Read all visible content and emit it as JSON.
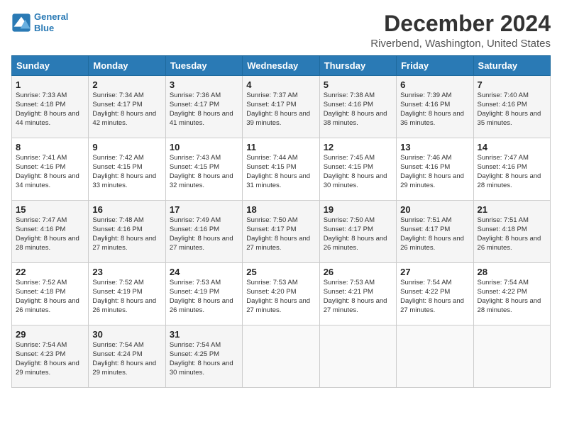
{
  "header": {
    "logo_line1": "General",
    "logo_line2": "Blue",
    "month": "December 2024",
    "location": "Riverbend, Washington, United States"
  },
  "weekdays": [
    "Sunday",
    "Monday",
    "Tuesday",
    "Wednesday",
    "Thursday",
    "Friday",
    "Saturday"
  ],
  "weeks": [
    [
      {
        "day": "1",
        "sunrise": "7:33 AM",
        "sunset": "4:18 PM",
        "daylight": "8 hours and 44 minutes."
      },
      {
        "day": "2",
        "sunrise": "7:34 AM",
        "sunset": "4:17 PM",
        "daylight": "8 hours and 42 minutes."
      },
      {
        "day": "3",
        "sunrise": "7:36 AM",
        "sunset": "4:17 PM",
        "daylight": "8 hours and 41 minutes."
      },
      {
        "day": "4",
        "sunrise": "7:37 AM",
        "sunset": "4:17 PM",
        "daylight": "8 hours and 39 minutes."
      },
      {
        "day": "5",
        "sunrise": "7:38 AM",
        "sunset": "4:16 PM",
        "daylight": "8 hours and 38 minutes."
      },
      {
        "day": "6",
        "sunrise": "7:39 AM",
        "sunset": "4:16 PM",
        "daylight": "8 hours and 36 minutes."
      },
      {
        "day": "7",
        "sunrise": "7:40 AM",
        "sunset": "4:16 PM",
        "daylight": "8 hours and 35 minutes."
      }
    ],
    [
      {
        "day": "8",
        "sunrise": "7:41 AM",
        "sunset": "4:16 PM",
        "daylight": "8 hours and 34 minutes."
      },
      {
        "day": "9",
        "sunrise": "7:42 AM",
        "sunset": "4:15 PM",
        "daylight": "8 hours and 33 minutes."
      },
      {
        "day": "10",
        "sunrise": "7:43 AM",
        "sunset": "4:15 PM",
        "daylight": "8 hours and 32 minutes."
      },
      {
        "day": "11",
        "sunrise": "7:44 AM",
        "sunset": "4:15 PM",
        "daylight": "8 hours and 31 minutes."
      },
      {
        "day": "12",
        "sunrise": "7:45 AM",
        "sunset": "4:15 PM",
        "daylight": "8 hours and 30 minutes."
      },
      {
        "day": "13",
        "sunrise": "7:46 AM",
        "sunset": "4:16 PM",
        "daylight": "8 hours and 29 minutes."
      },
      {
        "day": "14",
        "sunrise": "7:47 AM",
        "sunset": "4:16 PM",
        "daylight": "8 hours and 28 minutes."
      }
    ],
    [
      {
        "day": "15",
        "sunrise": "7:47 AM",
        "sunset": "4:16 PM",
        "daylight": "8 hours and 28 minutes."
      },
      {
        "day": "16",
        "sunrise": "7:48 AM",
        "sunset": "4:16 PM",
        "daylight": "8 hours and 27 minutes."
      },
      {
        "day": "17",
        "sunrise": "7:49 AM",
        "sunset": "4:16 PM",
        "daylight": "8 hours and 27 minutes."
      },
      {
        "day": "18",
        "sunrise": "7:50 AM",
        "sunset": "4:17 PM",
        "daylight": "8 hours and 27 minutes."
      },
      {
        "day": "19",
        "sunrise": "7:50 AM",
        "sunset": "4:17 PM",
        "daylight": "8 hours and 26 minutes."
      },
      {
        "day": "20",
        "sunrise": "7:51 AM",
        "sunset": "4:17 PM",
        "daylight": "8 hours and 26 minutes."
      },
      {
        "day": "21",
        "sunrise": "7:51 AM",
        "sunset": "4:18 PM",
        "daylight": "8 hours and 26 minutes."
      }
    ],
    [
      {
        "day": "22",
        "sunrise": "7:52 AM",
        "sunset": "4:18 PM",
        "daylight": "8 hours and 26 minutes."
      },
      {
        "day": "23",
        "sunrise": "7:52 AM",
        "sunset": "4:19 PM",
        "daylight": "8 hours and 26 minutes."
      },
      {
        "day": "24",
        "sunrise": "7:53 AM",
        "sunset": "4:19 PM",
        "daylight": "8 hours and 26 minutes."
      },
      {
        "day": "25",
        "sunrise": "7:53 AM",
        "sunset": "4:20 PM",
        "daylight": "8 hours and 27 minutes."
      },
      {
        "day": "26",
        "sunrise": "7:53 AM",
        "sunset": "4:21 PM",
        "daylight": "8 hours and 27 minutes."
      },
      {
        "day": "27",
        "sunrise": "7:54 AM",
        "sunset": "4:22 PM",
        "daylight": "8 hours and 27 minutes."
      },
      {
        "day": "28",
        "sunrise": "7:54 AM",
        "sunset": "4:22 PM",
        "daylight": "8 hours and 28 minutes."
      }
    ],
    [
      {
        "day": "29",
        "sunrise": "7:54 AM",
        "sunset": "4:23 PM",
        "daylight": "8 hours and 29 minutes."
      },
      {
        "day": "30",
        "sunrise": "7:54 AM",
        "sunset": "4:24 PM",
        "daylight": "8 hours and 29 minutes."
      },
      {
        "day": "31",
        "sunrise": "7:54 AM",
        "sunset": "4:25 PM",
        "daylight": "8 hours and 30 minutes."
      },
      null,
      null,
      null,
      null
    ]
  ]
}
